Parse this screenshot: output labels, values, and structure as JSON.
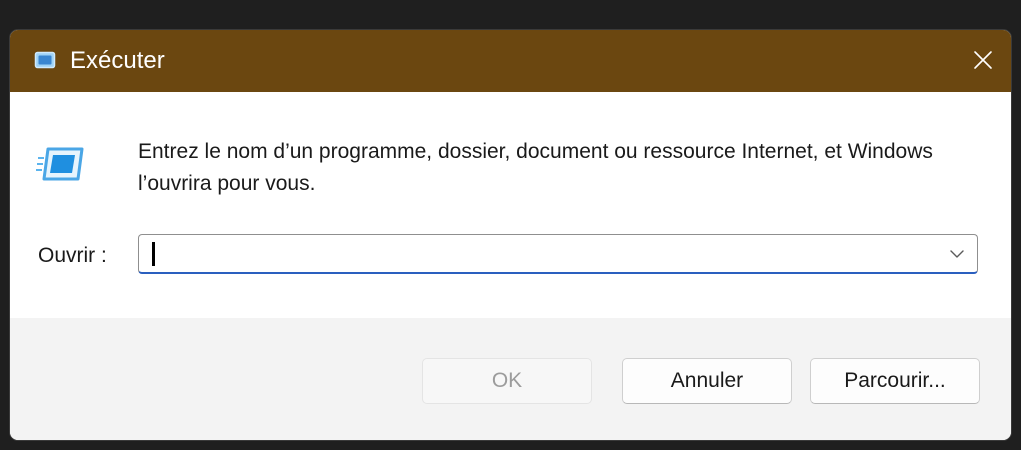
{
  "window": {
    "title": "Exécuter",
    "title_icon": "run-icon",
    "close_icon": "close-icon",
    "titlebar_color": "#6b4710"
  },
  "content": {
    "description": "Entrez le nom d’un programme, dossier, document ou ressource Internet, et Windows l’ouvrira pour vous.",
    "open_label": "Ouvrir :",
    "open_value": "",
    "dropdown_icon": "chevron-down-icon",
    "accent_color": "#2a5fbf"
  },
  "buttons": {
    "ok": "OK",
    "cancel": "Annuler",
    "browse": "Parcourir..."
  }
}
